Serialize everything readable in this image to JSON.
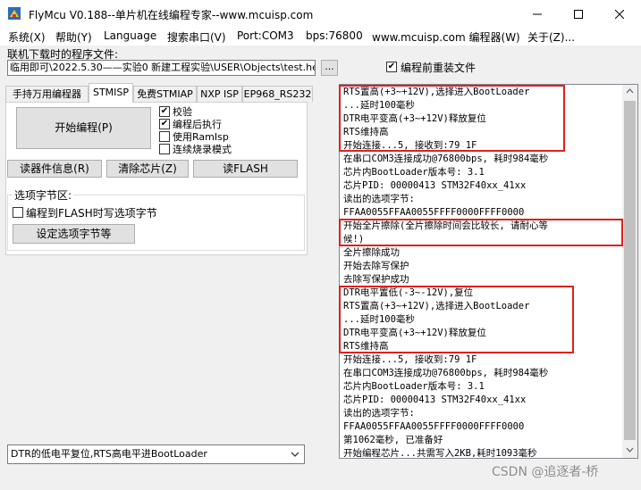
{
  "window": {
    "title": "FlyMcu V0.188--单片机在线编程专家--www.mcuisp.com",
    "minimize_icon": "minimize-icon",
    "maximize_icon": "maximize-icon",
    "close_icon": "close-icon"
  },
  "menu": {
    "items": [
      "系统(X)",
      "帮助(Y)",
      "Language",
      "搜索串口(V)",
      "Port:COM3",
      "bps:76800",
      "www.mcuisp.com 编程器(W)",
      "关于(Z)..."
    ]
  },
  "file": {
    "caption": "联机下载时的程序文件:",
    "path": "临用即可\\2022.5.30——实验0 新建工程实验\\USER\\Objects\\test.hex",
    "browse_label": "...",
    "preload_label": "编程前重装文件",
    "preload_checked": true
  },
  "tabs": [
    "手持万用编程器",
    "STMISP",
    "免费STMIAP",
    "NXP ISP",
    "EP968_RS232"
  ],
  "active_tab": "STMISP",
  "stmisp": {
    "start_button": "开始编程(P)",
    "options": [
      {
        "label": "校验",
        "checked": true
      },
      {
        "label": "编程后执行",
        "checked": true
      },
      {
        "label": "使用RamIsp",
        "checked": false
      },
      {
        "label": "连续烧录模式",
        "checked": false
      }
    ],
    "read_info_button": "读器件信息(R)",
    "erase_button": "清除芯片(Z)",
    "read_flash_button": "读FLASH",
    "option_group_title": "选项字节区:",
    "write_option_label": "编程到FLASH时写选项字节",
    "write_option_checked": false,
    "set_option_button": "设定选项字节等"
  },
  "reset_mode": {
    "selected": "DTR的低电平复位,RTS高电平进BootLoader",
    "arrow_icon": "chevron-down-icon"
  },
  "log": {
    "lines": [
      "RTS置高(+3~+12V),选择进入BootLoader",
      "...延时100毫秒",
      "DTR电平变高(+3~+12V)释放复位",
      "RTS维持高",
      "开始连接...5, 接收到:79 1F",
      "在串口COM3连接成功@76800bps, 耗时984毫秒",
      "芯片内BootLoader版本号: 3.1",
      "芯片PID: 00000413  STM32F40xx_41xx",
      "读出的选项字节:",
      "FFAA0055FFAA0055FFFF0000FFFF0000",
      "开始全片擦除(全片擦除时间会比较长, 请耐心等",
      "候!)",
      "全片擦除成功",
      "开始去除写保护",
      "去除写保护成功",
      "DTR电平置低(-3~-12V),复位",
      "RTS置高(+3~+12V),选择进入BootLoader",
      "...延时100毫秒",
      "DTR电平变高(+3~+12V)释放复位",
      "RTS维持高",
      "开始连接...5, 接收到:79 1F",
      "在串口COM3连接成功@76800bps, 耗时984毫秒",
      "芯片内BootLoader版本号: 3.1",
      "芯片PID: 00000413  STM32F40xx_41xx",
      "读出的选项字节:",
      "FFAA0055FFAA0055FFFF0000FFFF0000",
      "第1062毫秒, 已准备好",
      "开始编程芯片...共需写入2KB,耗时1093毫秒"
    ]
  },
  "watermark": "CSDN @追逐者-桥",
  "colors": {
    "highlight_box": "#e02020",
    "log_bg": "#ffffff"
  }
}
